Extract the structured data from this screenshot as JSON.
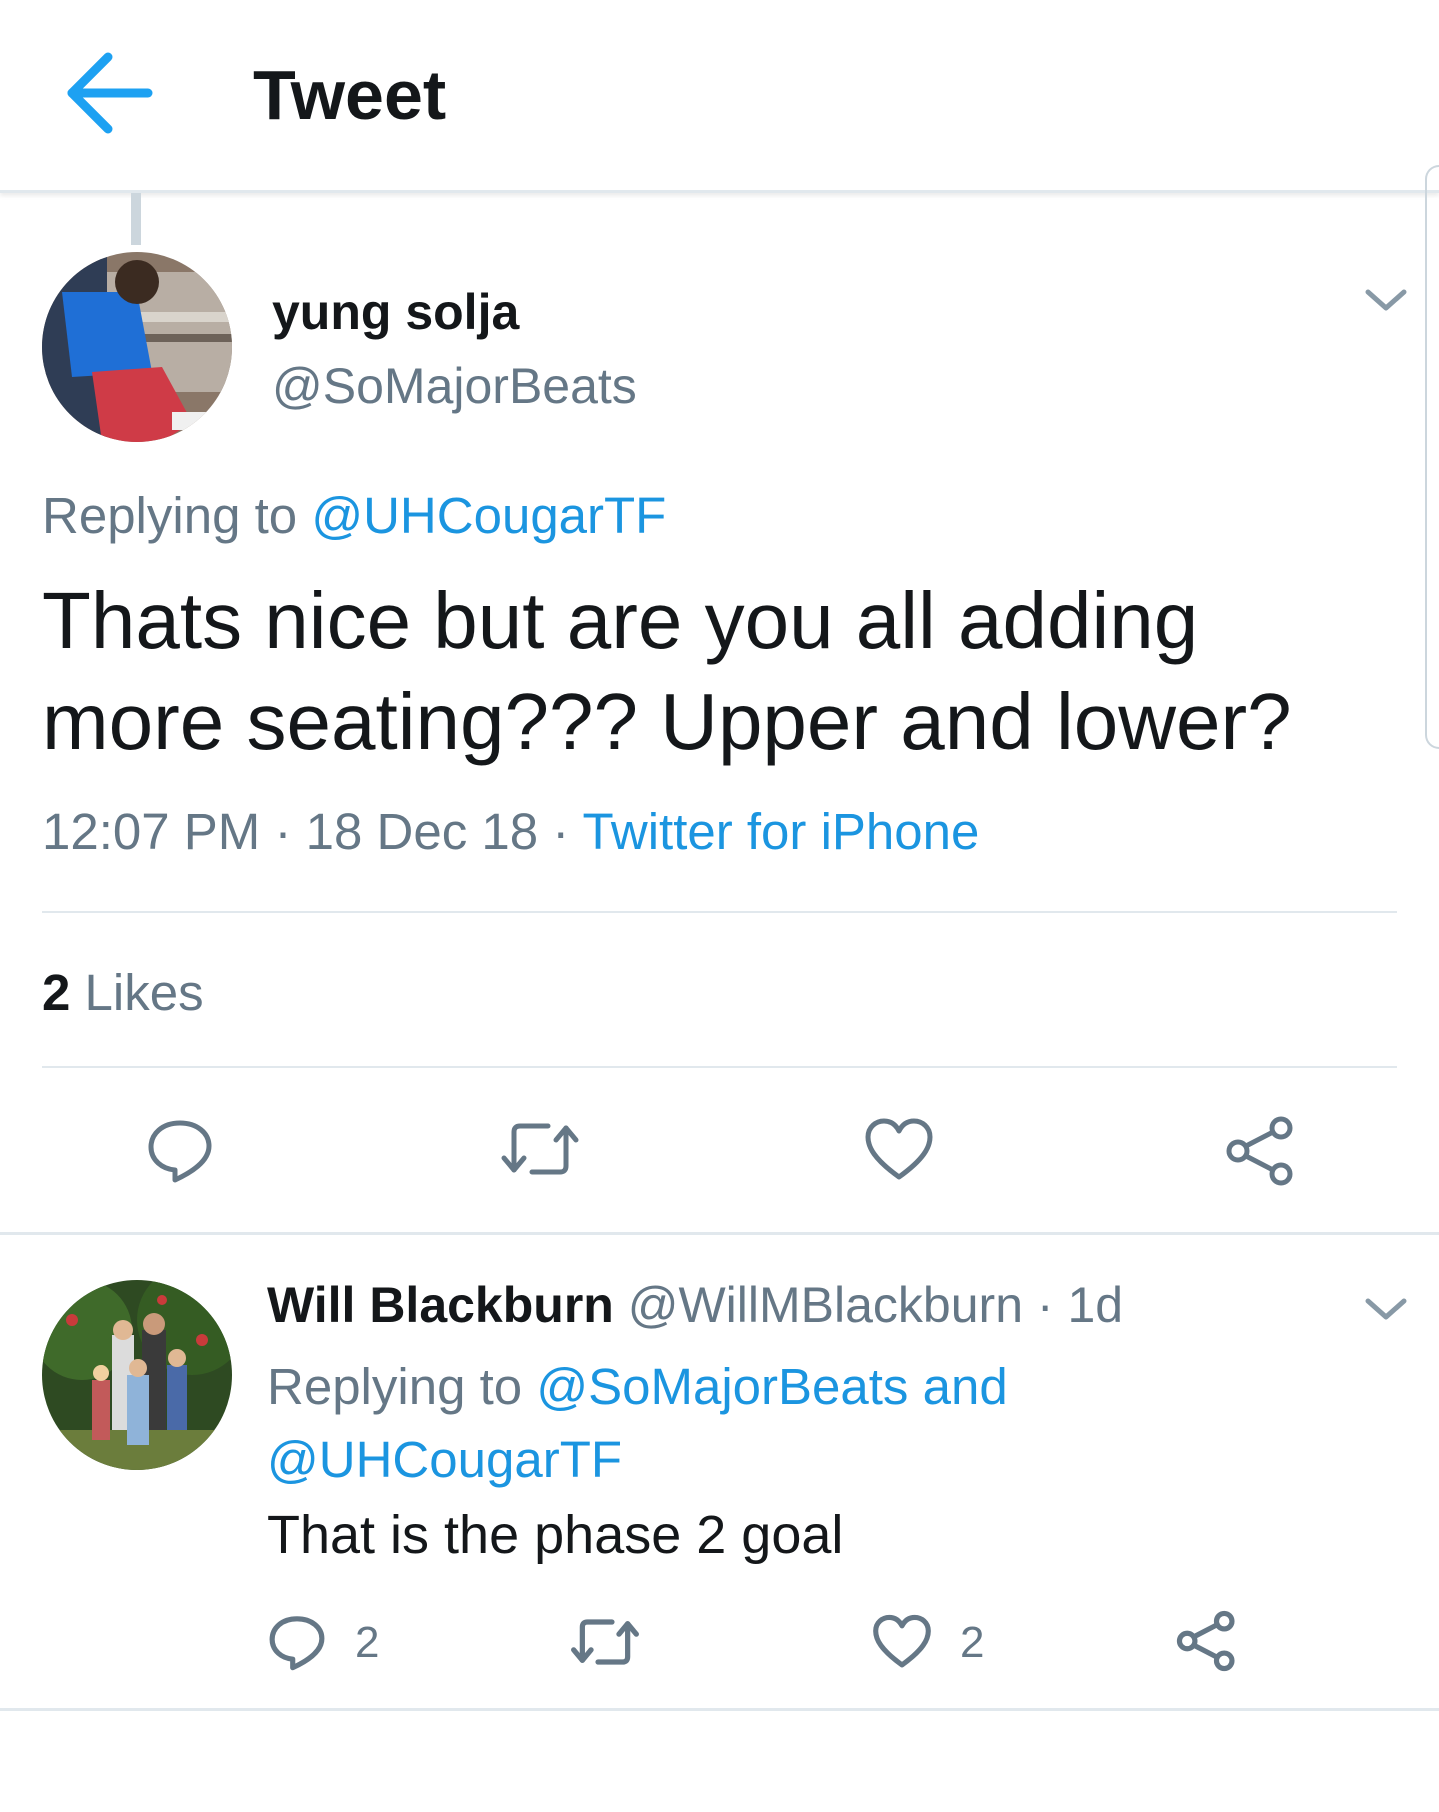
{
  "header": {
    "title": "Tweet",
    "back_icon": "arrow-left-icon",
    "accent": "#1da1f2"
  },
  "tweet": {
    "author_name": "yung solja",
    "author_handle": "@SoMajorBeats",
    "replying_prefix": "Replying to",
    "replying_to": "@UHCougarTF",
    "text": "Thats nice but are you all adding more seating??? Upper and lower?",
    "time": "12:07 PM",
    "sep1": "·",
    "date": "18 Dec 18",
    "sep2": "·",
    "source": "Twitter for iPhone",
    "likes_count": "2",
    "likes_label": "Likes",
    "actions": [
      "reply-icon",
      "retweet-icon",
      "like-icon",
      "share-icon"
    ]
  },
  "reply": {
    "author_name": "Will Blackburn",
    "author_handle": "@WillMBlackburn",
    "sep": "·",
    "age": "1d",
    "replying_prefix": "Replying to",
    "replying_to_1": "@SoMajorBeats",
    "replying_and": "and",
    "replying_to_2": "@UHCougarTF",
    "text": "That is the phase 2 goal",
    "reply_count": "2",
    "like_count": "2"
  },
  "colors": {
    "link": "#1b95e0",
    "muted": "#657786",
    "text": "#14171a",
    "divider": "#e1e8ed"
  }
}
